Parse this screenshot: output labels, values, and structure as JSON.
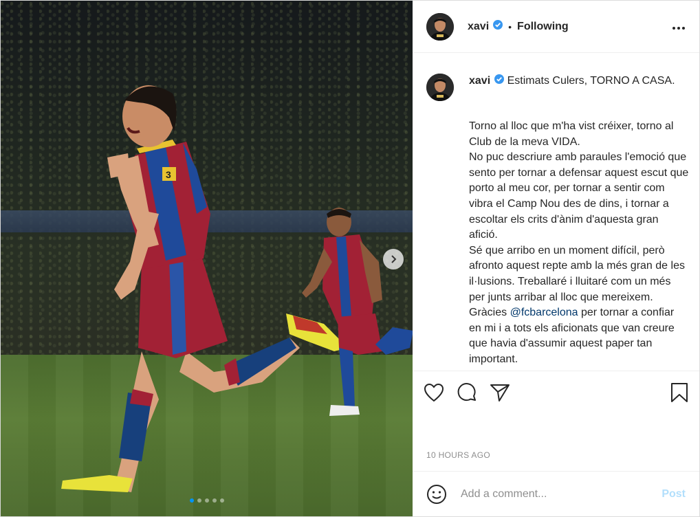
{
  "header": {
    "username": "xavi",
    "separator": "•",
    "follow_state": "Following",
    "more_icon": "more-horizontal-icon"
  },
  "caption": {
    "username": "xavi",
    "first_line": "Estimats Culers, TORNO A CASA.",
    "part1": "Torno al lloc que m'ha vist créixer, torno al Club de la meva VIDA.\nNo puc descriure amb paraules l'emoció que sento per tornar a defensar aquest escut que porto al meu cor, per tornar a sentir com vibra el Camp Nou des de dins, i tornar a escoltar els crits d'ànim d'aquesta gran afició.\nSé que arribo en un moment difícil, però afronto aquest repte amb la més gran de les il·lusions. Treballaré i lluitaré com un més per junts arribar al lloc que mereixem.\nGràcies ",
    "mention": "@fcbarcelona",
    "part2": " per tornar a confiar en mi i a tots els aficionats que van creure que havia d'assumir aquest paper tan important."
  },
  "media": {
    "player_number": "3",
    "carousel_count": 5,
    "carousel_active": 1
  },
  "meta": {
    "timestamp": "10 HOURS AGO"
  },
  "comment": {
    "placeholder": "Add a comment...",
    "post_label": "Post"
  },
  "colors": {
    "verified": "#3897f0",
    "post_disabled": "#b2dffc",
    "mention": "#00376b",
    "carousel_active": "#0095f6"
  }
}
